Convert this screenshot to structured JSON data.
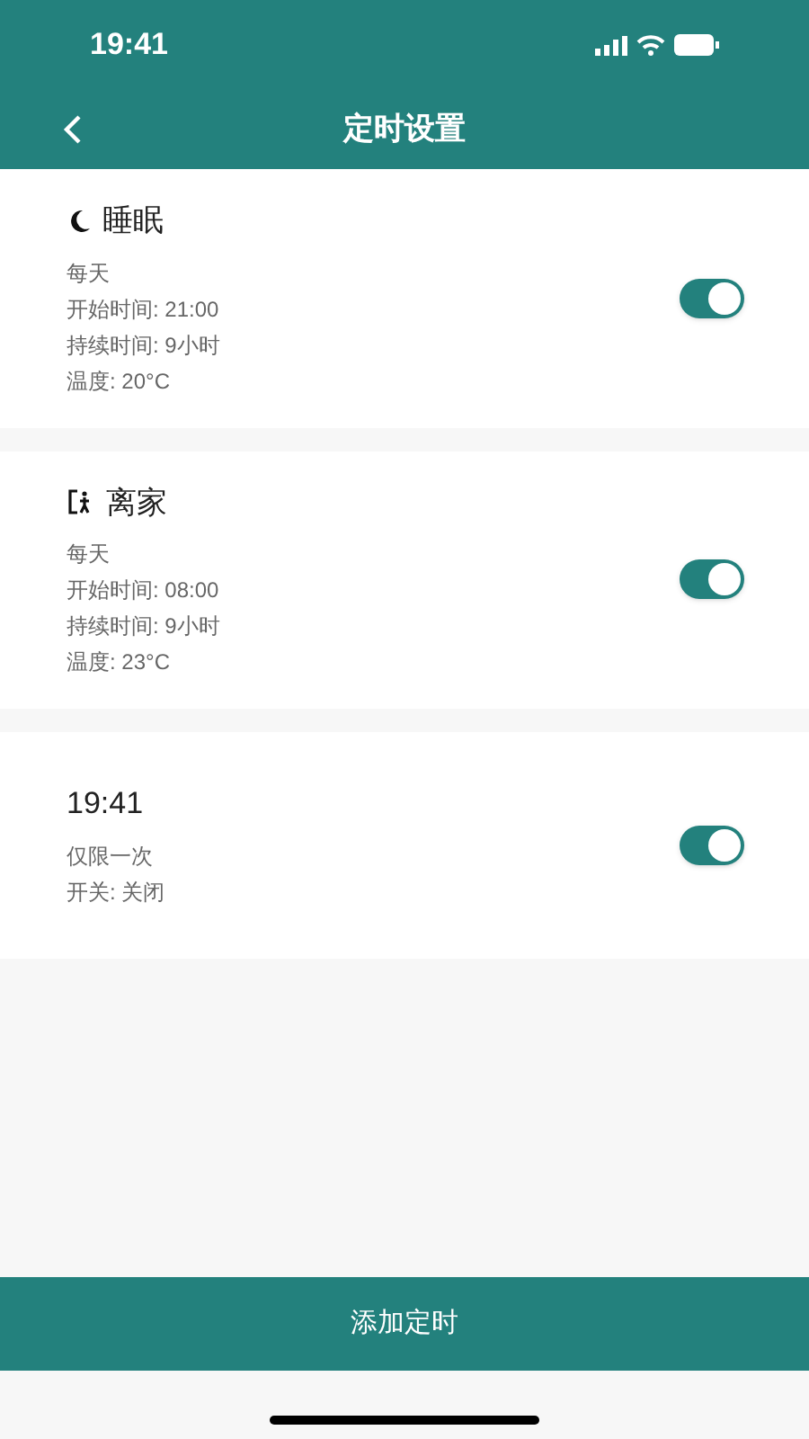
{
  "status_bar": {
    "time": "19:41"
  },
  "header": {
    "title": "定时设置"
  },
  "schedules": [
    {
      "kind": "sleep",
      "title": "睡眠",
      "lines": [
        "每天",
        "开始时间: 21:00",
        "持续时间: 9小时",
        "温度: 20°C"
      ],
      "on": true
    },
    {
      "kind": "away",
      "title": "离家",
      "lines": [
        "每天",
        "开始时间: 08:00",
        "持续时间: 9小时",
        "温度: 23°C"
      ],
      "on": true
    },
    {
      "kind": "plain",
      "title": "19:41",
      "lines": [
        "仅限一次",
        "开关: 关闭"
      ],
      "on": true
    }
  ],
  "add_button": {
    "label": "添加定时"
  }
}
